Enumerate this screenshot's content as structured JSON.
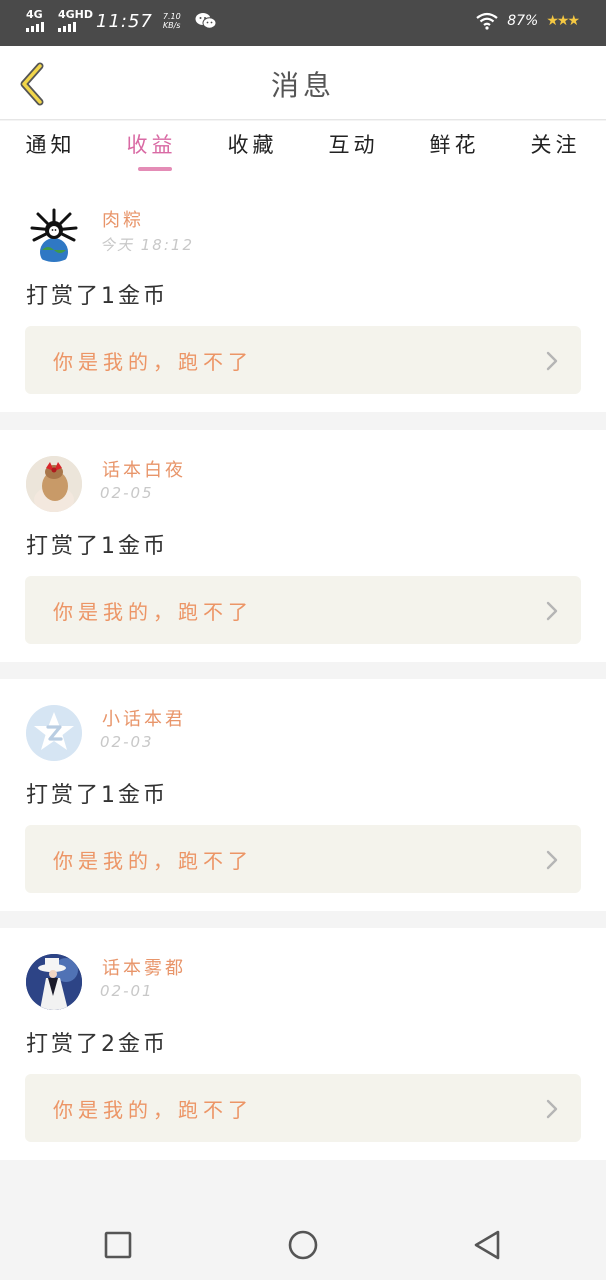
{
  "statusbar": {
    "network1": "4G",
    "network2": "4GHD",
    "time": "11:57",
    "speed_value": "7.10",
    "speed_unit": "KB/s",
    "wechat_icon": "wechat-icon",
    "battery": "87%",
    "stars": "★★★"
  },
  "header": {
    "back_icon": "chevron-left-icon",
    "title": "消息"
  },
  "tabs": [
    {
      "label": "通知"
    },
    {
      "label": "收益",
      "active": true
    },
    {
      "label": "收藏"
    },
    {
      "label": "互动"
    },
    {
      "label": "鲜花"
    },
    {
      "label": "关注"
    }
  ],
  "messages": [
    {
      "name": "肉粽",
      "time": "今天 18:12",
      "text": "打赏了1金币",
      "quote": "你是我的，跑不了"
    },
    {
      "name": "话本白夜",
      "time": "02-05",
      "text": "打赏了1金币",
      "quote": "你是我的，跑不了"
    },
    {
      "name": "小话本君",
      "time": "02-03",
      "text": "打赏了1金币",
      "quote": "你是我的，跑不了"
    },
    {
      "name": "话本雾都",
      "time": "02-01",
      "text": "打赏了2金币",
      "quote": "你是我的，跑不了"
    }
  ],
  "colors": {
    "accent_pink": "#d96aa4",
    "name_orange": "#e8956a",
    "quote_bg": "#f4f3ec"
  },
  "navbar": {
    "recent_icon": "square-icon",
    "home_icon": "circle-icon",
    "back_icon": "triangle-back-icon"
  }
}
